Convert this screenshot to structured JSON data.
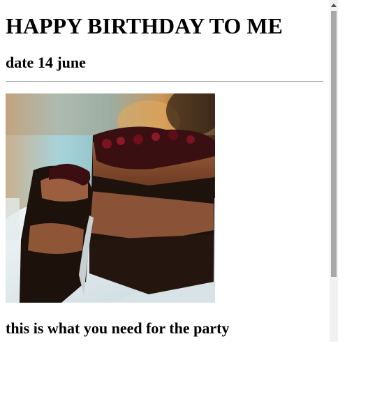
{
  "page": {
    "title": "HAPPY BIRTHDAY TO ME",
    "date": "date 14 june",
    "note": "this is what you need for the party"
  },
  "image": {
    "subject": "chocolate-cake-slice"
  },
  "scrollbar": {
    "position": 0
  }
}
